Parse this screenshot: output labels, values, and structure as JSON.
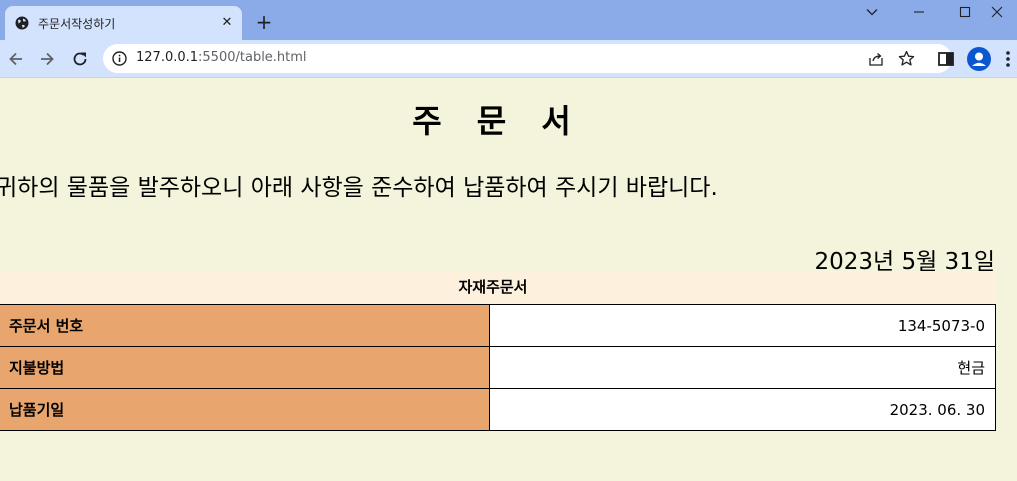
{
  "browser": {
    "tab_title": "주문서작성하기",
    "url_host": "127.0.0.1",
    "url_rest": ":5500/table.html"
  },
  "page": {
    "title": "주 문 서",
    "intro": "귀하의 물품을 발주하오니 아래 사항을 준수하여 납품하여 주시기 바랍니다.",
    "date": "2023년 5월 31일"
  },
  "order_table": {
    "caption": "자재주문서",
    "rows": [
      {
        "label": "주문서 번호",
        "value": "134-5073-0"
      },
      {
        "label": "지불방법",
        "value": "현금"
      },
      {
        "label": "납품기일",
        "value": "2023. 06. 30"
      }
    ]
  },
  "icons": {
    "favicon": "globe-icon",
    "back": "arrow-left-icon",
    "forward": "arrow-right-icon",
    "reload": "reload-icon",
    "info": "info-icon",
    "share": "share-icon",
    "bookmark": "star-icon",
    "side_panel": "side-panel-icon",
    "profile": "profile-icon",
    "menu": "kebab-menu-icon"
  },
  "colors": {
    "tabbar": "#8aabe8",
    "toolbar": "#d3e3fd",
    "page_bg": "#f4f4dc",
    "caption_bg": "#fdf1dd",
    "label_cell": "#e9a56e",
    "value_cell": "#ffffff"
  }
}
